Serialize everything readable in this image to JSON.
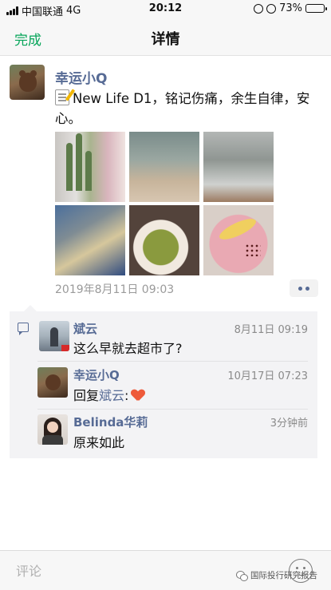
{
  "status_bar": {
    "carrier": "中国联通",
    "network": "4G",
    "time": "20:12",
    "battery": "73%",
    "battery_level": 0.73
  },
  "nav": {
    "done_label": "完成",
    "title": "详情"
  },
  "post": {
    "author": "幸运小Q",
    "icon": "memo-pencil-icon",
    "text": "New Life D1，铭记伤痛，余生自律，安心。",
    "time": "2019年8月11日 09:03",
    "photo_count": 6
  },
  "comments": [
    {
      "name": "斌云",
      "time": "8月11日 09:19",
      "text": "这么早就去超市了?"
    },
    {
      "name": "幸运小Q",
      "time": "10月17日 07:23",
      "reply_prefix": "回复",
      "reply_to": "斌云",
      "reply_suffix": ":",
      "icon": "heart-icon"
    },
    {
      "name": "Belinda华莉",
      "time": "3分钟前",
      "text": "原来如此"
    }
  ],
  "bottom": {
    "comment_placeholder": "评论"
  },
  "watermark": {
    "text": "国际投行研究报告"
  },
  "colors": {
    "accent_green": "#07a55a",
    "link_blue": "#576b95",
    "heart_red": "#ee5a3a"
  }
}
